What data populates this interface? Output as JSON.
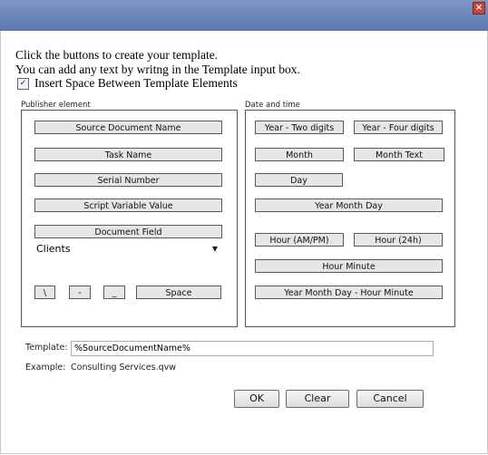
{
  "dialog": {
    "close_glyph": "×",
    "instructions": {
      "line1": "Click the buttons to create your template.",
      "line2": "You can add any text by writng in the Template input box."
    },
    "insert_space": {
      "label": "Insert Space Between Template Elements",
      "checked": true,
      "check_glyph": "✓"
    }
  },
  "publisher": {
    "title": "Publisher element",
    "buttons": {
      "source_document_name": "Source Document Name",
      "task_name": "Task Name",
      "serial_number": "Serial Number",
      "script_variable_value": "Script Variable Value",
      "document_field": "Document Field"
    },
    "document_field_select": {
      "value": "Clients",
      "arrow": "▼"
    },
    "symbols": {
      "backslash": "\\",
      "dash": "-",
      "underscore": "_",
      "space": "Space"
    }
  },
  "datetime": {
    "title": "Date and time",
    "buttons": {
      "year_two_digits": "Year - Two digits",
      "year_four_digits": "Year - Four digits",
      "month": "Month",
      "month_text": "Month Text",
      "day": "Day",
      "year_month_day": "Year Month Day",
      "hour_ampm": "Hour (AM/PM)",
      "hour_24h": "Hour (24h)",
      "hour_minute": "Hour Minute",
      "year_month_day_hour_minute": "Year Month Day - Hour Minute"
    }
  },
  "template": {
    "label": "Template:",
    "value": "%SourceDocumentName%",
    "example_label": "Example:",
    "example_value": "Consulting Services.qvw"
  },
  "actions": {
    "ok": "OK",
    "clear": "Clear",
    "cancel": "Cancel"
  }
}
